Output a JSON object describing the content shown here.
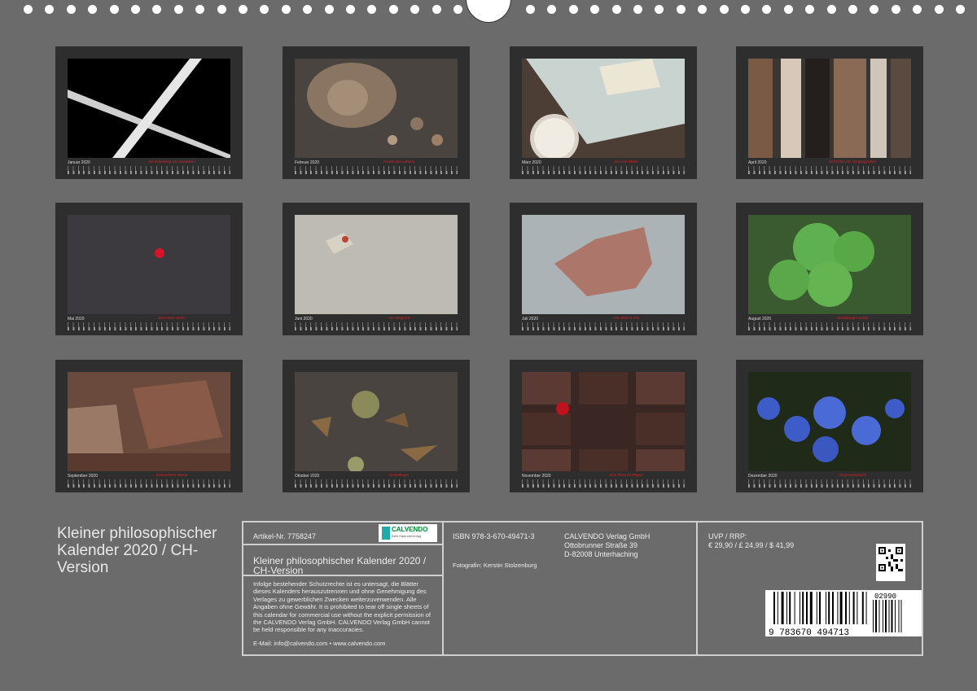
{
  "months": [
    {
      "name": "January",
      "label": "Januar 2020",
      "caption": "Am Kreuzweg der Gedanken"
    },
    {
      "name": "February",
      "label": "Februar 2020",
      "caption": "Puzzle des Lebens"
    },
    {
      "name": "March",
      "label": "März 2020",
      "caption": "Zeit und Worte"
    },
    {
      "name": "April",
      "label": "April 2020",
      "caption": "Schichten der Vergangenheit"
    },
    {
      "name": "May",
      "label": "Mai 2020",
      "caption": "Eins unter vielen"
    },
    {
      "name": "June",
      "label": "Juni 2020",
      "caption": "Am Wegrand"
    },
    {
      "name": "July",
      "label": "Juli 2020",
      "caption": "Das Blatt im Eis"
    },
    {
      "name": "August",
      "label": "August 2020",
      "caption": "Vierblättriges Glück"
    },
    {
      "name": "September",
      "label": "September 2020",
      "caption": "Gebrochene Steine"
    },
    {
      "name": "October",
      "label": "Oktober 2020",
      "caption": "Herbstkugel"
    },
    {
      "name": "November",
      "label": "November 2020",
      "caption": "Eine Rose im Regen"
    },
    {
      "name": "December",
      "label": "Dezember 2020",
      "caption": "Vergissmeinnicht"
    }
  ],
  "footer": {
    "title": "Kleiner philosophischer Kalender 2020 / CH-Version",
    "article": "Artikel-Nr. 7758247",
    "logo_text": "CALVENDO",
    "logo_sub": "Dein Kalenderverlag",
    "product_title": "Kleiner philosophischer Kalender 2020 / CH-Version",
    "isbn": "ISBN 978-3-670-49471-3",
    "photographer": "Fotografin: Kerstin Stolzenburg",
    "publisher_line1": "CALVENDO Verlag GmbH",
    "publisher_line2": "Ottobrunner Straße 39",
    "publisher_line3": "D-82008 Unterhaching",
    "price_label": "UVP / RRP:",
    "prices": "€ 29,90 / £ 24,99 / $ 41,99",
    "legal": "Infolge bestehender Schutzrechte ist es untersagt, die Blätter dieses Kalenders herauszutrennen und ohne Genehmigung des Verlages zu gewerblichen Zwecken weiterzuverwenden. Alle Angaben ohne Gewähr. It is prohibited to tear off single sheets of this calendar for commercial use without the explicit permission of the CALVENDO Verlag GmbH. CALVENDO Verlag GmbH cannot be held responsible for any inaccuracies.",
    "contact": "E-Mail: info@calvendo.com • www.calvendo.com",
    "barcode_number": "9 783670 494713",
    "barcode_addon": "02990"
  }
}
